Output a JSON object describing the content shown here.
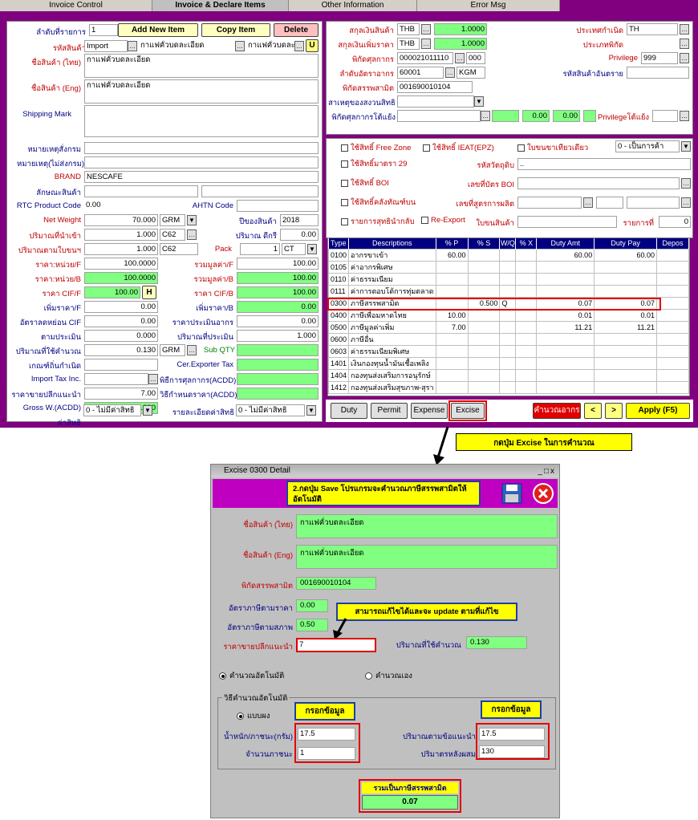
{
  "tabs": [
    "Invoice Control",
    "Invoice & Declare Items",
    "Other Information",
    "Error Msg"
  ],
  "left": {
    "item_no_label": "ลำดับที่รายการ",
    "item_no": "1",
    "btn_add": "Add New Item",
    "btn_copy": "Copy Item",
    "btn_delete": "Delete",
    "product_code_label": "รหัสสินค้า",
    "product_code": "Import",
    "product_code_desc": "กาแฟคั่วบดละเอียด",
    "product_code_desc2": "กาแฟคั่วบดละ",
    "u_btn": "U",
    "name_th_label": "ชื่อสินค้า (ไทย)",
    "name_th": "กาแฟคั่วบดละเอียด",
    "name_en_label": "ชื่อสินค้า (Eng)",
    "name_en": "กาแฟคั่วบดละเอียด",
    "shipping_label": "Shipping Mark",
    "note1_label": "หมายเหตุสั่งกรม",
    "note2_label": "หมายเหตุ(ไม่ส่งกรม)",
    "brand_label": "BRAND",
    "brand": "NESCAFE",
    "feature_label": "ลักษณะสินค้า",
    "rtc_label": "RTC Product Code",
    "rtc": "0.00",
    "ahtn_label": "AHTN Code",
    "net_weight_label": "Net Weight",
    "net_weight": "70.000",
    "net_weight_unit": "GRM",
    "year_label": "ปีของสินค้า",
    "year": "2018",
    "qty_label": "ปริมาณที่นำเข้า",
    "qty": "1.000",
    "qty_unit": "C62",
    "qty_tax_label": "ปริมาณ ดีกรี",
    "qty_tax": "0.00",
    "inv_qty_label": "ปริมาณตามใบขนฯ",
    "inv_qty": "1.000",
    "inv_qty_unit": "C62",
    "pack_label": "Pack",
    "pack": "1",
    "pack_unit": "CT",
    "price_f_label": "ราคา:หน่วย/F",
    "price_f": "100.0000",
    "total_f_label": "รวมมูลค่า/F",
    "total_f": "100.00",
    "price_b_label": "ราคา:หน่วย/B",
    "price_b": "100.0000",
    "total_b_label": "รวมมูลค่า/B",
    "total_b": "100.00",
    "cif_f_label": "ราคา CIF/F",
    "cif_f": "100.00",
    "h_btn": "H",
    "cif_b_label": "ราคา CIF/B",
    "cif_b": "100.00",
    "add_f_label": "เพิ่มราคา/F",
    "add_f": "0.00",
    "add_b_label": "เพิ่มราคา/B",
    "add_b": "0.00",
    "disc_label": "อัตราลดหย่อน CIF",
    "disc": "0.00",
    "assess_label": "ราคาประเมินอากร",
    "assess": "0.00",
    "assess2_label": "ตามประเมิน",
    "assess2": "0.000",
    "assess_qty_label": "ปริมาณที่ประเมิน",
    "assess_qty": "1.000",
    "calc_qty_label": "ปริมาณที่ใช้คำนวณ",
    "calc_qty": "0.130",
    "calc_unit": "GRM",
    "sub_qty_label": "Sub QTY",
    "origin_rule_label": "เกณฑ์ถิ่นกำเนิด",
    "cer_label": "Cer.Exporter Tax",
    "import_tax_label": "Import Tax Inc.",
    "acdd1_label": "พิธีการศุลกากร(ACDD)",
    "retail_label": "ราคาขายปลีกแนะนำ",
    "retail": "7.00",
    "acdd2_label": "วิธีกำหนดราคา(ACDD)",
    "gross_label": "Gross W.(ACDD)",
    "gross": "0.000",
    "right_label": "ค่าสิทธิ",
    "right_val": "0 - ไม่มีค่าสิทธิ",
    "right_detail_label": "รายละเอียดค่าสิทธิ",
    "right_detail_val": "0 - ไม่มีค่าสิทธิ"
  },
  "right": {
    "cur_label": "สกุลเงินสินค้า",
    "cur": "THB",
    "rate": "1.0000",
    "cur2_label": "สกุลเงินเพิ่มราคา",
    "cur2": "THB",
    "rate2": "1.0000",
    "tariff_label": "พิกัดศุลกากร",
    "tariff": "000021011110",
    "tariff_suffix": "000",
    "stat_label": "ลำดับอัตราอากร",
    "stat": "60001",
    "stat_unit": "KGM",
    "excise_label": "พิกัดสรรพสามิต",
    "excise": "001690010104",
    "reason_label": "สาเหตุของสงวนสิทธิ",
    "tariff_adj_label": "พิกัดศุลกากรโต้แย้ง",
    "tariff_adj_v1": "0.00",
    "tariff_adj_v2": "0.00",
    "origin_label": "ประเทศกำเนิด",
    "origin": "TH",
    "privilege_type_label": "ประเภทพิกัด",
    "privilege_label": "Privilege",
    "privilege": "999",
    "danger_label": "รหัสสินค้าอันตราย",
    "privilege_adj_label": "Privilegeโต้แย้ง"
  },
  "checks": {
    "free_zone": "ใช้สิทธิ์ Free Zone",
    "ieat": "ใช้สิทธิ์ IEAT(EPZ)",
    "transit": "ใบขนขาเทียวเดียว",
    "transit_sel": "0 - เป็นการค้า",
    "sec29": "ใช้สิทธิ์มาตรา 29",
    "sec29_code_label": "รหัสวัตถุดิบ",
    "sec29_code": "..",
    "boi": "ใช้สิทธิ์ BOI",
    "boi_card_label": "เลขที่บัตร BOI",
    "bonded": "ใช้สิทธิ์คลังทัณฑ์บน",
    "formula_label": "เลขที่สูตรการผลิต",
    "refund": "รายการสุทธินำกลับ",
    "reexport": "Re-Export",
    "inv_label": "ใบขนสินค้า",
    "item_label": "รายการที่",
    "item_val": "0"
  },
  "grid": {
    "headers": [
      "Type",
      "Descriptions",
      "% P",
      "% S",
      "W/Q",
      "% X",
      "Duty Amt",
      "Duty Pay",
      "Depos"
    ],
    "rows": [
      [
        "0100",
        "อากรขาเข้า",
        "60.00",
        "",
        "",
        "",
        "60.00",
        "60.00",
        ""
      ],
      [
        "0105",
        "ค่าอากรพิเศษ",
        "",
        "",
        "",
        "",
        "",
        "",
        ""
      ],
      [
        "0110",
        "ค่าธรรมเนียม",
        "",
        "",
        "",
        "",
        "",
        "",
        ""
      ],
      [
        "0111",
        "ค่าการตอบโต้การทุ่มตลาด",
        "",
        "",
        "",
        "",
        "",
        "",
        ""
      ],
      [
        "0300",
        "ภาษีสรรพสามิต",
        "",
        "0.500",
        "Q",
        "",
        "0.07",
        "0.07",
        ""
      ],
      [
        "0400",
        "ภาษีเพื่อมหาดไทย",
        "10.00",
        "",
        "",
        "",
        "0.01",
        "0.01",
        ""
      ],
      [
        "0500",
        "ภาษีมูลค่าเพิ่ม",
        "7.00",
        "",
        "",
        "",
        "11.21",
        "11.21",
        ""
      ],
      [
        "0600",
        "ภาษีอื่น",
        "",
        "",
        "",
        "",
        "",
        "",
        ""
      ],
      [
        "0603",
        "ค่าธรรมเนียมพิเศษ",
        "",
        "",
        "",
        "",
        "",
        "",
        ""
      ],
      [
        "1401",
        "เงินกองทุนน้ำมันเชื้อเพลิง",
        "",
        "",
        "",
        "",
        "",
        "",
        ""
      ],
      [
        "1404",
        "กองทุนส่งเสริมการอนุรักษ์",
        "",
        "",
        "",
        "",
        "",
        "",
        ""
      ],
      [
        "1412",
        "กองทุนส่งเสริมสุขภาพ-สุรา",
        "",
        "",
        "",
        "",
        "",
        "",
        ""
      ]
    ]
  },
  "buttons": {
    "duty": "Duty",
    "permit": "Permit",
    "expense": "Expense",
    "excise": "Excise",
    "calc": "คำนวณอากร",
    "prev": "<",
    "next": ">",
    "apply": "Apply (F5)"
  },
  "callout1": "กดปุ่ม Excise ในการคำนวณ",
  "dialog": {
    "title": "Excise 0300 Detail",
    "win_btns": "_□x",
    "note": "2.กดปุ่ม Save โปรแกรมจะคำนวณภาษีสรรพสามิตให้อัตโนมัติ",
    "name_th_label": "ชื่อสินค้า (ไทย)",
    "name_th": "กาแฟคั่วบดละเอียด",
    "name_en_label": "ชื่อสินค้า (Eng)",
    "name_en": "กาแฟคั่วบดละเอียด",
    "excise_code_label": "พิกัดสรรพสามิต",
    "excise_code": "001690010104",
    "rate_value_label": "อัตราภาษีตามราคา",
    "rate_value": "0.00",
    "rate_qty_label": "อัตราภาษีตามสภาพ",
    "rate_qty": "0.50",
    "edit_note": "สามารถแก้ไขได้และจะ update ตามที่แก้ไข",
    "retail_label": "ราคาขายปลีกแนะนำ",
    "retail": "7",
    "qty_used_label": "ปริมาณที่ใช้คำนวณ",
    "qty_used": "0.130",
    "auto_label": "คำนวณอัตโนมัติ",
    "manual_label": "คำนวณเอง",
    "method_label": "วิธีคำนวณอัตโนมัติ",
    "split_label": "แบบผง",
    "fill1": "กรอกข้อมูล",
    "fill2": "กรอกข้อมูล",
    "weight_label": "น้ำหนัก/ภาชนะ(กรัม)",
    "weight": "17.5",
    "containers_label": "จำนวนภาชนะ",
    "containers": "1",
    "qty_label_label": "ปริมาณตามข้อแนะนำ",
    "qty_label": "17.5",
    "qty_after_label": "ปริมาตรหลังผสม",
    "qty_after": "130",
    "total_label": "รวมเป็นภาษีสรรพสามิต",
    "total": "0.07"
  }
}
